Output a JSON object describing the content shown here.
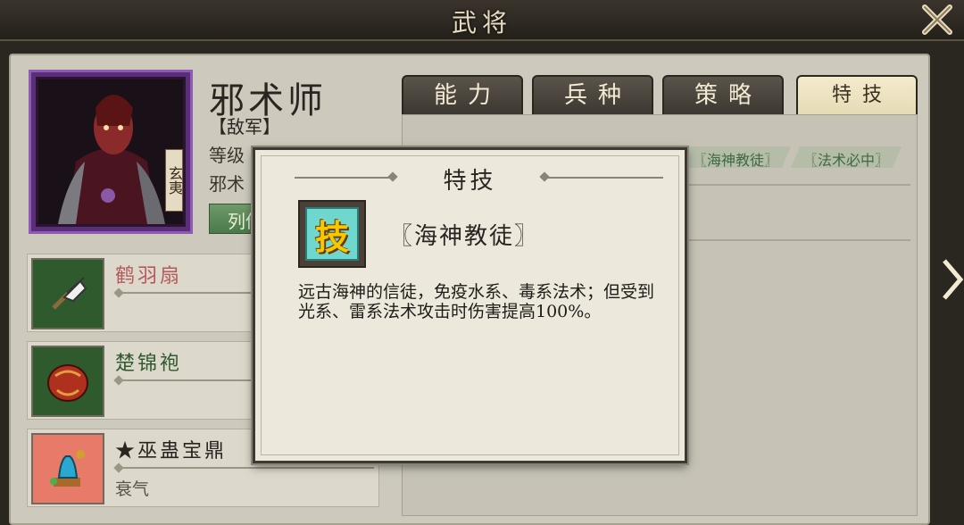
{
  "header": {
    "title": "武将"
  },
  "general": {
    "name": "邪术师",
    "faction": "【敌军】",
    "level_label": "等级",
    "class_label": "邪术",
    "portrait_tag": "玄夷",
    "biography_button": "列传"
  },
  "equipment": [
    {
      "name": "鹤羽扇",
      "sub": "",
      "name_color": "#b45a5a"
    },
    {
      "name": "楚锦袍",
      "sub": "",
      "name_color": "#2e5a2e"
    },
    {
      "name": "★巫蛊宝鼎",
      "sub": "衰气",
      "name_color": "#2a2520"
    }
  ],
  "tabs": [
    {
      "label": "能力",
      "active": false
    },
    {
      "label": "兵种",
      "active": false
    },
    {
      "label": "策略",
      "active": false
    },
    {
      "label": "特技",
      "active": true
    }
  ],
  "skills": [
    "〖海神教徒〗",
    "〖法术必中〗"
  ],
  "popup": {
    "title": "特技",
    "icon_glyph": "技",
    "skill_name": "〖海神教徒〗",
    "description": "远古海神的信徒，免疫水系、毒系法术；但受到光系、雷系法术攻击时伤害提高100%。"
  }
}
